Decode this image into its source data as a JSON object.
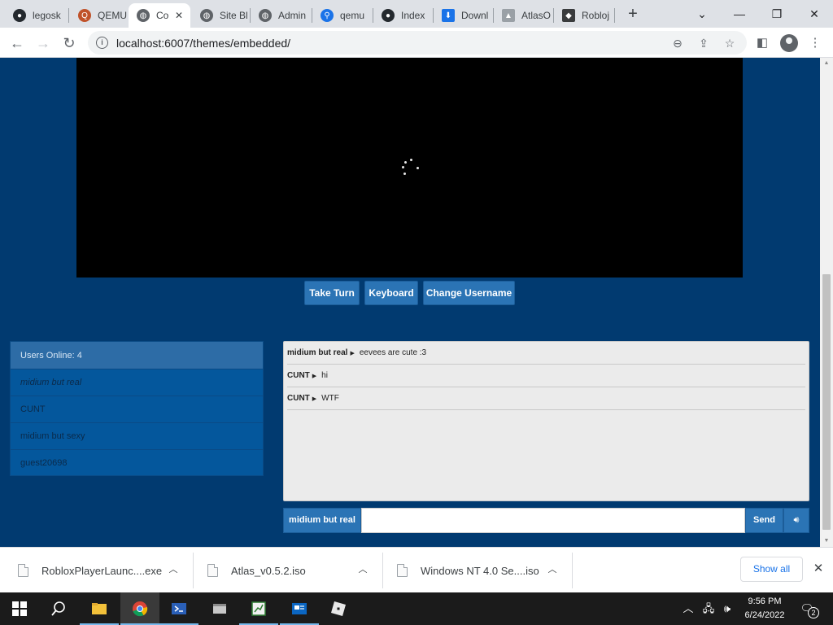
{
  "browser": {
    "tabs": [
      {
        "label": "legosk",
        "icon": "github-icon"
      },
      {
        "label": "QEMU",
        "icon": "qemu-icon"
      },
      {
        "label": "Co",
        "icon": "globe-icon",
        "active": true
      },
      {
        "label": "Site Bl",
        "icon": "globe-icon"
      },
      {
        "label": "Admin",
        "icon": "globe-icon"
      },
      {
        "label": "qemu",
        "icon": "search-icon"
      },
      {
        "label": "Index",
        "icon": "github-icon"
      },
      {
        "label": "Downl",
        "icon": "download-icon"
      },
      {
        "label": "AtlasO",
        "icon": "triangle-logo-icon"
      },
      {
        "label": "Robloj",
        "icon": "roblox-icon"
      }
    ],
    "url": "localhost:6007/themes/embedded/"
  },
  "vm": {
    "buttons": {
      "take_turn": "Take Turn",
      "keyboard": "Keyboard",
      "change_username": "Change Username"
    }
  },
  "users": {
    "header": "Users Online: 4",
    "list": [
      "midium but real",
      "CUNT",
      "midium but sexy",
      "guest20698"
    ]
  },
  "chat": {
    "messages": [
      {
        "user": "midium but real",
        "text": "eevees are cute :3"
      },
      {
        "user": "CUNT",
        "text": "hi"
      },
      {
        "user": "CUNT",
        "text": "WTF"
      }
    ],
    "username": "midium but real",
    "input_value": "",
    "send_label": "Send"
  },
  "downloads": {
    "items": [
      "RobloxPlayerLaunc....exe",
      "Atlas_v0.5.2.iso",
      "Windows NT 4.0 Se....iso"
    ],
    "show_all": "Show all"
  },
  "taskbar": {
    "time": "9:56 PM",
    "date": "6/24/2022",
    "notification_count": "2"
  },
  "colors": {
    "page_bg": "#013a70",
    "button_blue": "#2b74b5",
    "user_panel": "#04579c"
  }
}
